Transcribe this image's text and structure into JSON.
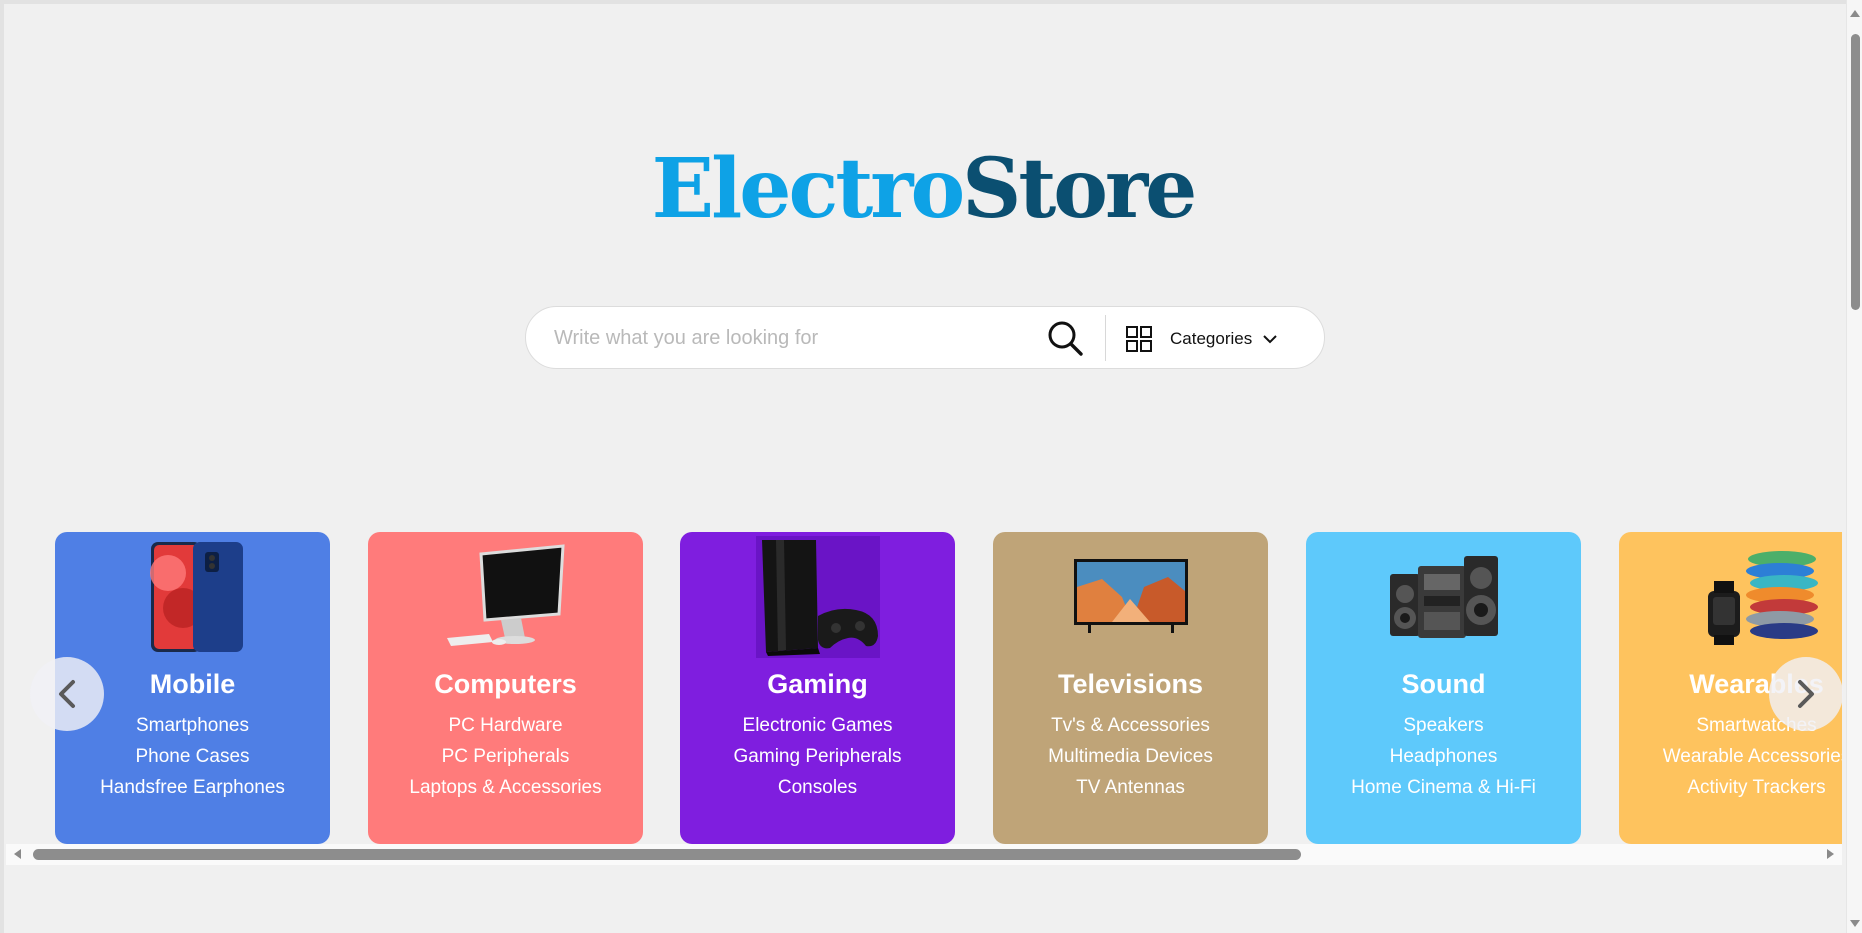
{
  "logo": {
    "part1": "Electro",
    "part2": "Store"
  },
  "search": {
    "placeholder": "Write what you are looking for",
    "value": "",
    "search_icon": "search-icon",
    "categories_label": "Categories",
    "categories_icon": "grid-icon",
    "dropdown_icon": "chevron-down-icon"
  },
  "carousel": {
    "prev_icon": "chevron-left-icon",
    "next_icon": "chevron-right-icon",
    "cards": [
      {
        "title": "Mobile",
        "color": "#4f7fe5",
        "image": "smartphone-image",
        "links": [
          "Smartphones",
          "Phone Cases",
          "Handsfree Earphones"
        ]
      },
      {
        "title": "Computers",
        "color": "#ff7b7b",
        "image": "desktop-computer-image",
        "links": [
          "PC Hardware",
          "PC Peripherals",
          "Laptops & Accessories"
        ]
      },
      {
        "title": "Gaming",
        "color": "#7f1edf",
        "image": "game-console-image",
        "links": [
          "Electronic Games",
          "Gaming Peripherals",
          "Consoles"
        ]
      },
      {
        "title": "Televisions",
        "color": "#bfa478",
        "image": "television-image",
        "links": [
          "Tv's & Accessories",
          "Multimedia Devices",
          "TV Antennas"
        ]
      },
      {
        "title": "Sound",
        "color": "#5ec9fb",
        "image": "stereo-speakers-image",
        "links": [
          "Speakers",
          "Headphones",
          "Home Cinema & Hi-Fi"
        ]
      },
      {
        "title": "Wearables",
        "color": "#fec35e",
        "image": "smartwatch-bands-image",
        "links": [
          "Smartwatches",
          "Wearable Accessories",
          "Activity Trackers"
        ]
      }
    ]
  }
}
